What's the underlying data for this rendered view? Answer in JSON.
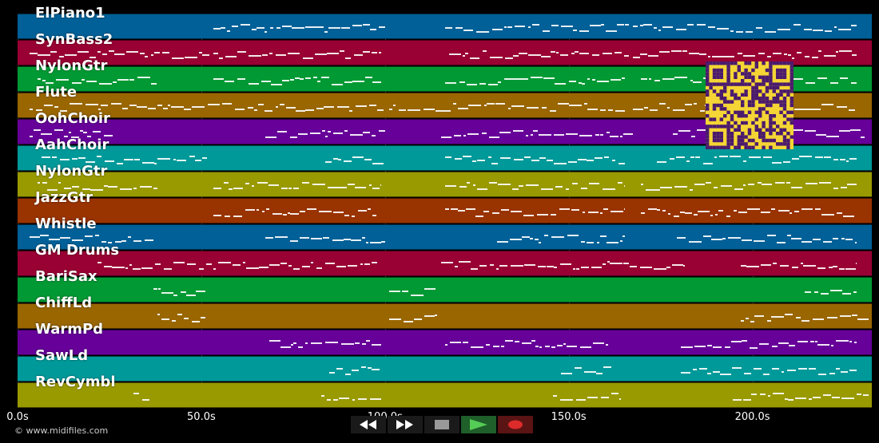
{
  "tracks": [
    {
      "name": "ElPiano1",
      "color": "#006097"
    },
    {
      "name": "SynBass2",
      "color": "#990033"
    },
    {
      "name": "NylonGtr",
      "color": "#009933"
    },
    {
      "name": "Flute",
      "color": "#996600"
    },
    {
      "name": "OohChoir",
      "color": "#660099"
    },
    {
      "name": "AahChoir",
      "color": "#009999"
    },
    {
      "name": "NylonGtr",
      "color": "#999900"
    },
    {
      "name": "JazzGtr",
      "color": "#993300"
    },
    {
      "name": "Whistle",
      "color": "#006097"
    },
    {
      "name": "GM Drums",
      "color": "#990033"
    },
    {
      "name": "BariSax",
      "color": "#009933"
    },
    {
      "name": "ChiffLd",
      "color": "#996600"
    },
    {
      "name": "WarmPd",
      "color": "#660099"
    },
    {
      "name": "SawLd",
      "color": "#009999"
    },
    {
      "name": "RevCymbl",
      "color": "#999900"
    }
  ],
  "timeline": {
    "max_seconds": 232.5,
    "ticks": [
      {
        "value": 0,
        "label": "0.0s"
      },
      {
        "value": 50,
        "label": "50.0s"
      },
      {
        "value": 100,
        "label": "100.0s"
      },
      {
        "value": 150,
        "label": "150.0s"
      },
      {
        "value": 200,
        "label": "200.0s"
      }
    ]
  },
  "transport": {
    "rewind": "rewind-icon",
    "fast_forward": "fast-forward-icon",
    "stop": "stop-icon",
    "play": "play-icon",
    "record": "record-icon"
  },
  "footer": {
    "copyright": "© www.midifiles.com"
  }
}
